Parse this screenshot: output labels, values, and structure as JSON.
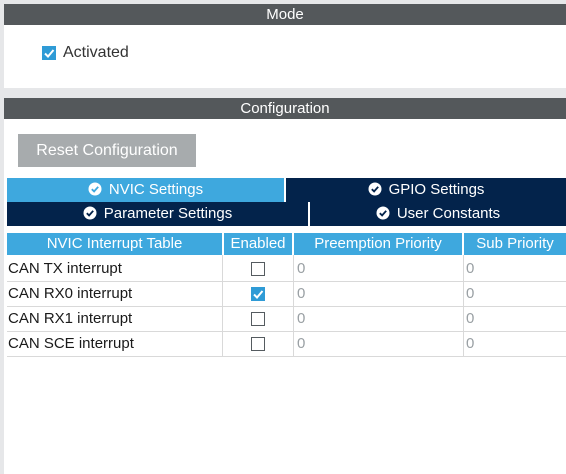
{
  "mode": {
    "title": "Mode",
    "activated_label": "Activated",
    "activated_checked": true
  },
  "configuration": {
    "title": "Configuration",
    "reset_button_label": "Reset Configuration",
    "tabs": [
      {
        "label": "NVIC Settings",
        "active": true
      },
      {
        "label": "GPIO Settings",
        "active": false
      },
      {
        "label": "Parameter Settings",
        "active": false
      },
      {
        "label": "User Constants",
        "active": false
      }
    ],
    "table": {
      "headers": [
        "NVIC Interrupt Table",
        "Enabled",
        "Preemption Priority",
        "Sub Priority"
      ],
      "rows": [
        {
          "name": "CAN TX interrupt",
          "enabled": false,
          "preemption": "0",
          "sub": "0"
        },
        {
          "name": "CAN RX0 interrupt",
          "enabled": true,
          "preemption": "0",
          "sub": "0"
        },
        {
          "name": "CAN RX1 interrupt",
          "enabled": false,
          "preemption": "0",
          "sub": "0"
        },
        {
          "name": "CAN SCE interrupt",
          "enabled": false,
          "preemption": "0",
          "sub": "0"
        }
      ]
    }
  },
  "colors": {
    "header_bar": "#54585b",
    "tab_active": "#3ea8de",
    "tab_inactive": "#03234b",
    "checkbox_checked": "#2f9bd6",
    "button_disabled": "#a7abad"
  }
}
